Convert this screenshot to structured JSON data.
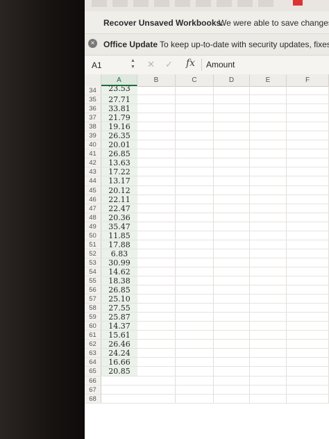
{
  "notification": {
    "recover_title": "Recover Unsaved Workbooks.",
    "recover_message": "We were able to save changes"
  },
  "update_bar": {
    "title": "Office Update",
    "message": "To keep up-to-date with security updates, fixes,"
  },
  "formula_bar": {
    "name_box": "A1",
    "fx_label": "fx",
    "content": "Amount"
  },
  "columns": [
    "A",
    "B",
    "C",
    "D",
    "E",
    "F"
  ],
  "rows": [
    {
      "num": "34",
      "a": "23.53"
    },
    {
      "num": "35",
      "a": "27.71"
    },
    {
      "num": "36",
      "a": "33.81"
    },
    {
      "num": "37",
      "a": "21.79"
    },
    {
      "num": "38",
      "a": "19.16"
    },
    {
      "num": "39",
      "a": "26.35"
    },
    {
      "num": "40",
      "a": "20.01"
    },
    {
      "num": "41",
      "a": "26.85"
    },
    {
      "num": "42",
      "a": "13.63"
    },
    {
      "num": "43",
      "a": "17.22"
    },
    {
      "num": "44",
      "a": "13.17"
    },
    {
      "num": "45",
      "a": "20.12"
    },
    {
      "num": "46",
      "a": "22.11"
    },
    {
      "num": "47",
      "a": "22.47"
    },
    {
      "num": "48",
      "a": "20.36"
    },
    {
      "num": "49",
      "a": "35.47"
    },
    {
      "num": "50",
      "a": "11.85"
    },
    {
      "num": "51",
      "a": "17.88"
    },
    {
      "num": "52",
      "a": "6.83"
    },
    {
      "num": "53",
      "a": "30.99"
    },
    {
      "num": "54",
      "a": "14.62"
    },
    {
      "num": "55",
      "a": "18.38"
    },
    {
      "num": "56",
      "a": "26.85"
    },
    {
      "num": "57",
      "a": "25.10"
    },
    {
      "num": "58",
      "a": "27.55"
    },
    {
      "num": "59",
      "a": "25.87"
    },
    {
      "num": "60",
      "a": "14.37"
    },
    {
      "num": "61",
      "a": "15.61"
    },
    {
      "num": "62",
      "a": "26.46"
    },
    {
      "num": "63",
      "a": "24.24"
    },
    {
      "num": "64",
      "a": "16.66"
    },
    {
      "num": "65",
      "a": "20.85"
    },
    {
      "num": "66",
      "a": ""
    },
    {
      "num": "67",
      "a": ""
    },
    {
      "num": "68",
      "a": ""
    }
  ]
}
